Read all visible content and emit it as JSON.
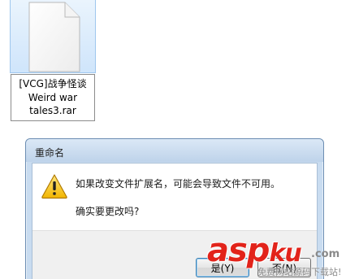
{
  "file": {
    "name_line1": "[VCG]战争怪谈",
    "name_line2": "Weird war",
    "name_line3": "tales3.rar",
    "icon": "blank-document-icon"
  },
  "dialog": {
    "title": "重命名",
    "icon": "warning-icon",
    "message": "如果改变文件扩展名，可能会导致文件不可用。",
    "question": "确实要更改吗?",
    "yes_label": "是(Y)",
    "no_label": "否(N)"
  },
  "watermark": {
    "logo_main": "asp",
    "logo_ku": "ku",
    "tld": ".com",
    "slogan": "免费网站源码下载站!"
  }
}
